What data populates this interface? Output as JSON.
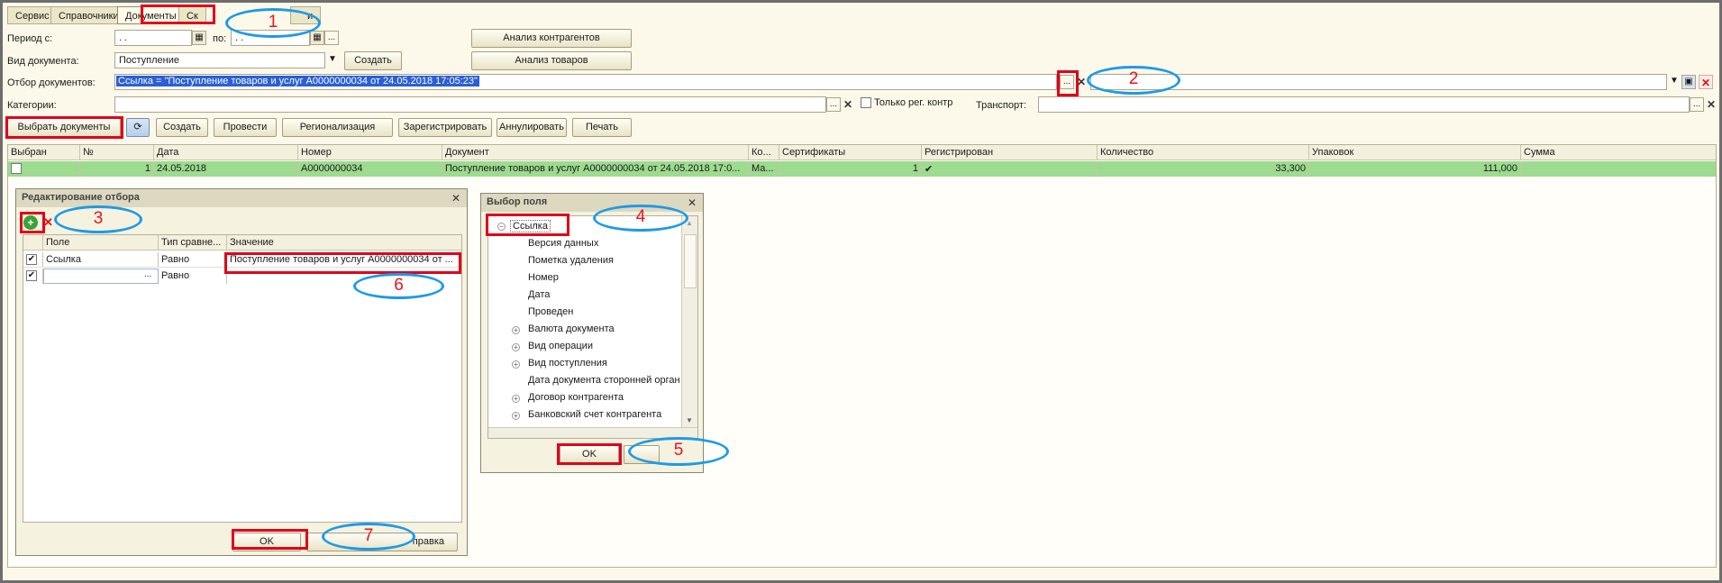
{
  "tabs": [
    {
      "label": "Сервис"
    },
    {
      "label": "Справочники"
    },
    {
      "label": "Документы"
    },
    {
      "label": "Ск"
    },
    {
      "label": "и"
    }
  ],
  "form": {
    "period_from_label": "Период с:",
    "period_from_value": ". .",
    "period_to_label": "по:",
    "period_to_value": ". .",
    "doc_type_label": "Вид документа:",
    "doc_type_value": "Поступление",
    "create_label": "Создать",
    "filter_label": "Отбор документов:",
    "filter_value": "Ссылка = \"Поступление товаров и услуг A0000000034 от 24.05.2018 17:05:23\"",
    "categories_label": "Категории:",
    "only_reg_label": "Только рег. контр",
    "transport_label": "Транспорт:",
    "ellipsis": "...",
    "clear_glyph": "✕",
    "analysis_contractors": "Анализ контрагентов",
    "analysis_goods": "Анализ товаров"
  },
  "toolbar": {
    "select_docs": "Выбрать документы",
    "create": "Создать",
    "post": "Провести",
    "regionalization": "Регионализация",
    "register": "Зарегистрировать",
    "cancel": "Аннулировать",
    "print": "Печать"
  },
  "grid": {
    "columns": [
      "Выбран",
      "№",
      "Дата",
      "Номер",
      "Документ",
      "Ко...",
      "Сертификаты",
      "Регистрирован",
      "Количество",
      "Упаковок",
      "Сумма"
    ],
    "rows": [
      {
        "selected": "",
        "num": "1",
        "date": "24.05.2018",
        "number": "A0000000034",
        "document": "Поступление товаров и услуг A0000000034 от 24.05.2018 17:0...",
        "ko": "Ма...",
        "certs": "1",
        "registered": "✔",
        "qty": "33,300",
        "packs": "111,000",
        "sum": ""
      }
    ]
  },
  "filter_dialog": {
    "title": "Редактирование отбора",
    "close": "✕",
    "columns": [
      "Поле",
      "Тип сравне...",
      "Значение"
    ],
    "rows": [
      {
        "field": "Ссылка",
        "cmp": "Равно",
        "value": "Поступление товаров и услуг A0000000034 от ..."
      },
      {
        "field": "",
        "cmp": "Равно",
        "value": ""
      }
    ],
    "ok": "OK",
    "help": "Справка",
    "help_visible": "правка"
  },
  "field_dialog": {
    "title": "Выбор поля",
    "close": "✕",
    "root": "Ссылка",
    "items": [
      {
        "label": "Версия данных",
        "expandable": false
      },
      {
        "label": "Пометка удаления",
        "expandable": false
      },
      {
        "label": "Номер",
        "expandable": false
      },
      {
        "label": "Дата",
        "expandable": false
      },
      {
        "label": "Проведен",
        "expandable": false
      },
      {
        "label": "Валюта документа",
        "expandable": true
      },
      {
        "label": "Вид операции",
        "expandable": true
      },
      {
        "label": "Вид поступления",
        "expandable": true
      },
      {
        "label": "Дата документа сторонней орган",
        "expandable": false
      },
      {
        "label": "Договор  контрагента",
        "expandable": true
      },
      {
        "label": "Банковский счет контрагента",
        "expandable": true
      }
    ],
    "ok": "OK"
  },
  "callouts": [
    "1",
    "2",
    "3",
    "4",
    "5",
    "6",
    "7"
  ],
  "colors": {
    "background": "#fdf9ea",
    "selected_row": "#9ddb8f",
    "annotation_red": "#e0001a",
    "annotation_blue": "#1e9be4"
  }
}
